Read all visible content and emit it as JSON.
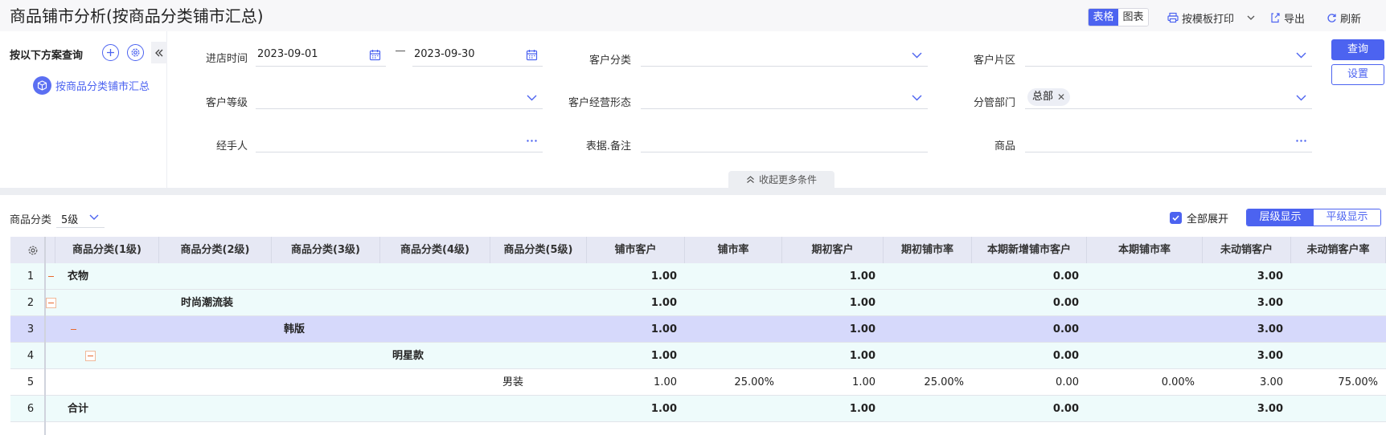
{
  "header": {
    "title": "商品铺市分析(按商品分类铺市汇总)",
    "view_table": "表格",
    "view_chart": "图表",
    "print": "按模板打印",
    "export": "导出",
    "refresh": "刷新"
  },
  "plan": {
    "label": "按以下方案查询",
    "item": "按商品分类铺市汇总"
  },
  "filters": {
    "date_label": "进店时间",
    "date_from": "2023-09-01",
    "date_to": "2023-09-30",
    "customer_class_label": "客户分类",
    "customer_area_label": "客户片区",
    "customer_level_label": "客户等级",
    "customer_form_label": "客户经营形态",
    "dept_label": "分管部门",
    "dept_tag": "总部",
    "handler_label": "经手人",
    "remark_label": "表据.备注",
    "product_label": "商品",
    "query": "查询",
    "settings": "设置",
    "collapse_more": "收起更多条件"
  },
  "toolbar": {
    "category_label": "商品分类",
    "category_level": "5级",
    "expand_all": "全部展开",
    "mode_tree": "层级显示",
    "mode_flat": "平级显示"
  },
  "table": {
    "columns": [
      "商品分类(1级)",
      "商品分类(2级)",
      "商品分类(3级)",
      "商品分类(4级)",
      "商品分类(5级)",
      "铺市客户",
      "铺市率",
      "期初客户",
      "期初铺市率",
      "本期新增铺市客户",
      "本期铺市率",
      "未动销客户",
      "未动销客户率"
    ],
    "rows": [
      {
        "idx": "1",
        "l1": "衣物",
        "l2": "",
        "l3": "",
        "l4": "",
        "l5": "",
        "shop": "1.00",
        "shop_rate": "",
        "init": "1.00",
        "init_rate": "",
        "new": "0.00",
        "cur_rate": "",
        "unsold": "3.00",
        "unsold_rate": ""
      },
      {
        "idx": "2",
        "l1": "",
        "l2": "时尚潮流装",
        "l3": "",
        "l4": "",
        "l5": "",
        "shop": "1.00",
        "shop_rate": "",
        "init": "1.00",
        "init_rate": "",
        "new": "0.00",
        "cur_rate": "",
        "unsold": "3.00",
        "unsold_rate": ""
      },
      {
        "idx": "3",
        "l1": "",
        "l2": "",
        "l3": "韩版",
        "l4": "",
        "l5": "",
        "shop": "1.00",
        "shop_rate": "",
        "init": "1.00",
        "init_rate": "",
        "new": "0.00",
        "cur_rate": "",
        "unsold": "3.00",
        "unsold_rate": ""
      },
      {
        "idx": "4",
        "l1": "",
        "l2": "",
        "l3": "",
        "l4": "明星款",
        "l5": "",
        "shop": "1.00",
        "shop_rate": "",
        "init": "1.00",
        "init_rate": "",
        "new": "0.00",
        "cur_rate": "",
        "unsold": "3.00",
        "unsold_rate": ""
      },
      {
        "idx": "5",
        "l1": "",
        "l2": "",
        "l3": "",
        "l4": "",
        "l5": "男装",
        "shop": "1.00",
        "shop_rate": "25.00%",
        "init": "1.00",
        "init_rate": "25.00%",
        "new": "0.00",
        "cur_rate": "0.00%",
        "unsold": "3.00",
        "unsold_rate": "75.00%"
      },
      {
        "idx": "6",
        "l1": "合计",
        "l2": "",
        "l3": "",
        "l4": "",
        "l5": "",
        "shop": "1.00",
        "shop_rate": "",
        "init": "1.00",
        "init_rate": "",
        "new": "0.00",
        "cur_rate": "",
        "unsold": "3.00",
        "unsold_rate": ""
      }
    ]
  },
  "colors": {
    "accent": "#4c63f0",
    "row_tint": "#eefbfb",
    "row_selected": "#d6d9fb",
    "row_plain": "#ffffff",
    "collapse_icon": "#e8692e"
  }
}
